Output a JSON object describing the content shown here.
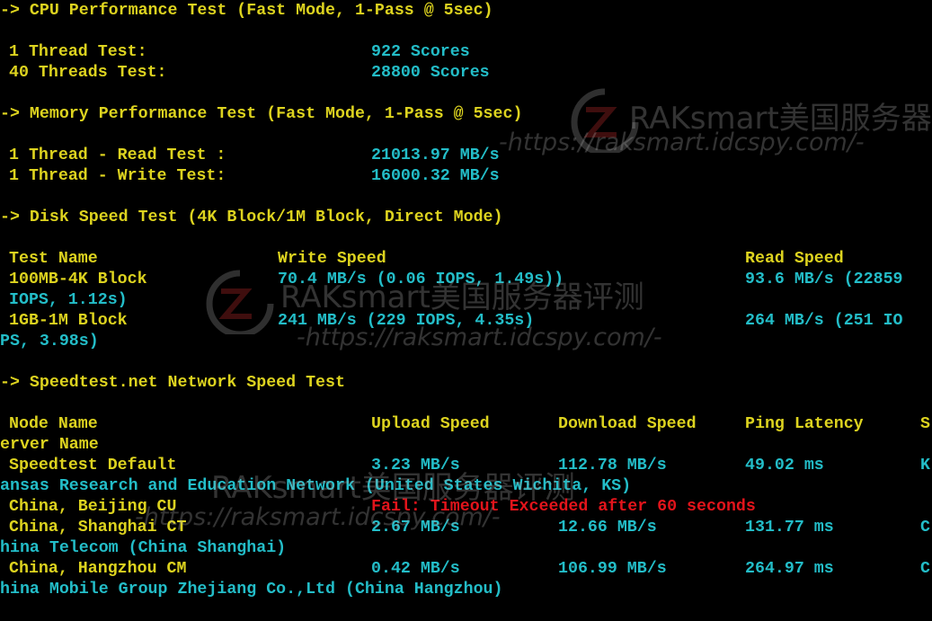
{
  "colors": {
    "background": "#000000",
    "label": "#ddd31f",
    "value": "#23bdc8",
    "error": "#e2141b"
  },
  "watermark": {
    "brand": "RAKsmart美国服务器评测",
    "url": "-https://raksmart.idcspy.com/-",
    "logo_icon": "zr-logo-icon"
  },
  "cpu": {
    "header": "-> CPU Performance Test (Fast Mode, 1-Pass @ 5sec)",
    "single_label": "1 Thread Test:",
    "single_value": "922 Scores",
    "multi_label": "40 Threads Test:",
    "multi_value": "28800 Scores"
  },
  "memory": {
    "header": "-> Memory Performance Test (Fast Mode, 1-Pass @ 5sec)",
    "read_label": "1 Thread - Read Test :",
    "read_value": "21013.97 MB/s",
    "write_label": "1 Thread - Write Test:",
    "write_value": "16000.32 MB/s"
  },
  "disk": {
    "header": "-> Disk Speed Test (4K Block/1M Block, Direct Mode)",
    "columns": [
      "Test Name",
      "Write Speed",
      "Read Speed"
    ],
    "rows": [
      {
        "name": "100MB-4K Block",
        "write": "70.4 MB/s (0.06 IOPS, 1.49s))",
        "read": "93.6 MB/s (22859",
        "read_wrap": "IOPS, 1.12s)"
      },
      {
        "name": "1GB-1M Block",
        "write": "241 MB/s (229 IOPS, 4.35s)",
        "read": "264 MB/s (251 IO",
        "read_wrap": "PS, 3.98s)"
      }
    ]
  },
  "network": {
    "header": "-> Speedtest.net Network Speed Test",
    "columns": [
      "Node Name",
      "Upload Speed",
      "Download Speed",
      "Ping Latency",
      "S"
    ],
    "columns_wrap": "erver Name",
    "rows": [
      {
        "node": "Speedtest Default",
        "upload": "3.23 MB/s",
        "download": "112.78 MB/s",
        "ping": "49.02 ms",
        "server_head": "K",
        "server_wrap": "ansas Research and Education Network (United States Wichita, KS)"
      },
      {
        "node": "China, Beijing CU",
        "error": "Fail: Timeout Exceeded after 60 seconds"
      },
      {
        "node": "China, Shanghai CT",
        "upload": "2.67 MB/s",
        "download": "12.66 MB/s",
        "ping": "131.77 ms",
        "server_head": "C",
        "server_wrap": "hina Telecom (China Shanghai)"
      },
      {
        "node": "China, Hangzhou CM",
        "upload": "0.42 MB/s",
        "download": "106.99 MB/s",
        "ping": "264.97 ms",
        "server_head": "C",
        "server_wrap": "hina Mobile Group Zhejiang Co.,Ltd (China Hangzhou)"
      }
    ]
  }
}
